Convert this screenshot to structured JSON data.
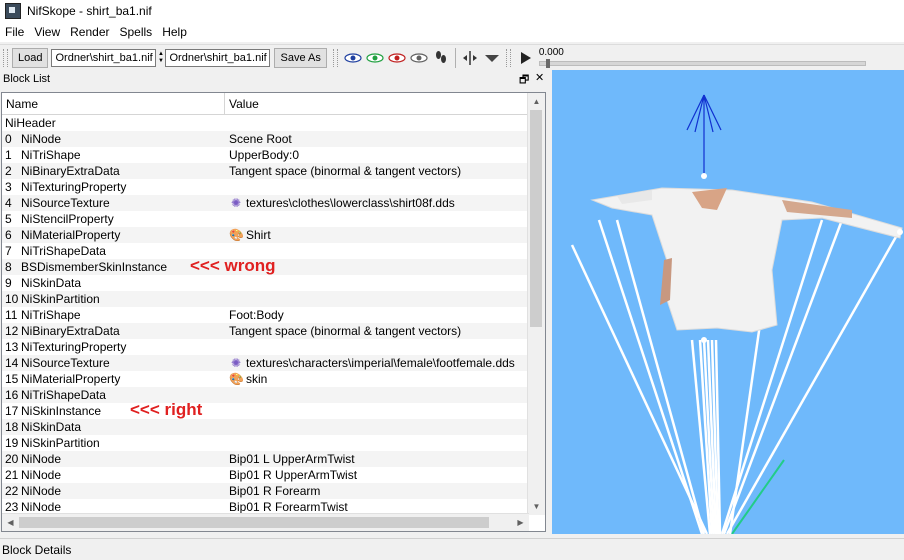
{
  "window": {
    "title": "NifSkope - shirt_ba1.nif"
  },
  "menu": [
    "File",
    "View",
    "Render",
    "Spells",
    "Help"
  ],
  "toolbar": {
    "load_label": "Load",
    "load_path": "Ordner\\shirt_ba1.nif",
    "save_path": "Ordner\\shirt_ba1.nif",
    "save_as_label": "Save As",
    "time_value": "0.000"
  },
  "block_list": {
    "title": "Block List",
    "columns": [
      "Name",
      "Value"
    ],
    "header_row": "NiHeader",
    "rows": [
      {
        "index": "0",
        "name": "NiNode",
        "value": "Scene Root",
        "icon": ""
      },
      {
        "index": "1",
        "name": "NiTriShape",
        "value": "UpperBody:0",
        "icon": ""
      },
      {
        "index": "2",
        "name": "NiBinaryExtraData",
        "value": "Tangent space (binormal & tangent vectors)",
        "icon": ""
      },
      {
        "index": "3",
        "name": "NiTexturingProperty",
        "value": "",
        "icon": ""
      },
      {
        "index": "4",
        "name": "NiSourceTexture",
        "value": "textures\\clothes\\lowerclass\\shirt08f.dds",
        "icon": "texture-icon"
      },
      {
        "index": "5",
        "name": "NiStencilProperty",
        "value": "",
        "icon": ""
      },
      {
        "index": "6",
        "name": "NiMaterialProperty",
        "value": "Shirt",
        "icon": "material-icon"
      },
      {
        "index": "7",
        "name": "NiTriShapeData",
        "value": "",
        "icon": ""
      },
      {
        "index": "8",
        "name": "BSDismemberSkinInstance",
        "value": "",
        "icon": ""
      },
      {
        "index": "9",
        "name": "NiSkinData",
        "value": "",
        "icon": ""
      },
      {
        "index": "10",
        "name": "NiSkinPartition",
        "value": "",
        "icon": ""
      },
      {
        "index": "11",
        "name": "NiTriShape",
        "value": "Foot:Body",
        "icon": ""
      },
      {
        "index": "12",
        "name": "NiBinaryExtraData",
        "value": "Tangent space (binormal & tangent vectors)",
        "icon": ""
      },
      {
        "index": "13",
        "name": "NiTexturingProperty",
        "value": "",
        "icon": ""
      },
      {
        "index": "14",
        "name": "NiSourceTexture",
        "value": "textures\\characters\\imperial\\female\\footfemale.dds",
        "icon": "texture-icon"
      },
      {
        "index": "15",
        "name": "NiMaterialProperty",
        "value": "skin",
        "icon": "material-icon"
      },
      {
        "index": "16",
        "name": "NiTriShapeData",
        "value": "",
        "icon": ""
      },
      {
        "index": "17",
        "name": "NiSkinInstance",
        "value": "",
        "icon": ""
      },
      {
        "index": "18",
        "name": "NiSkinData",
        "value": "",
        "icon": ""
      },
      {
        "index": "19",
        "name": "NiSkinPartition",
        "value": "",
        "icon": ""
      },
      {
        "index": "20",
        "name": "NiNode",
        "value": "Bip01 L UpperArmTwist",
        "icon": ""
      },
      {
        "index": "21",
        "name": "NiNode",
        "value": "Bip01 R UpperArmTwist",
        "icon": ""
      },
      {
        "index": "22",
        "name": "NiNode",
        "value": "Bip01 R Forearm",
        "icon": ""
      },
      {
        "index": "23",
        "name": "NiNode",
        "value": "Bip01 R ForearmTwist",
        "icon": ""
      }
    ],
    "annotations": [
      {
        "row_index": "8",
        "text": "<<< wrong"
      },
      {
        "row_index": "17",
        "text": "<<< right"
      }
    ]
  },
  "status_bar": {
    "label": "Block Details"
  },
  "colors": {
    "viewport_bg": "#6fb9fb",
    "annotation": "#e02020"
  }
}
